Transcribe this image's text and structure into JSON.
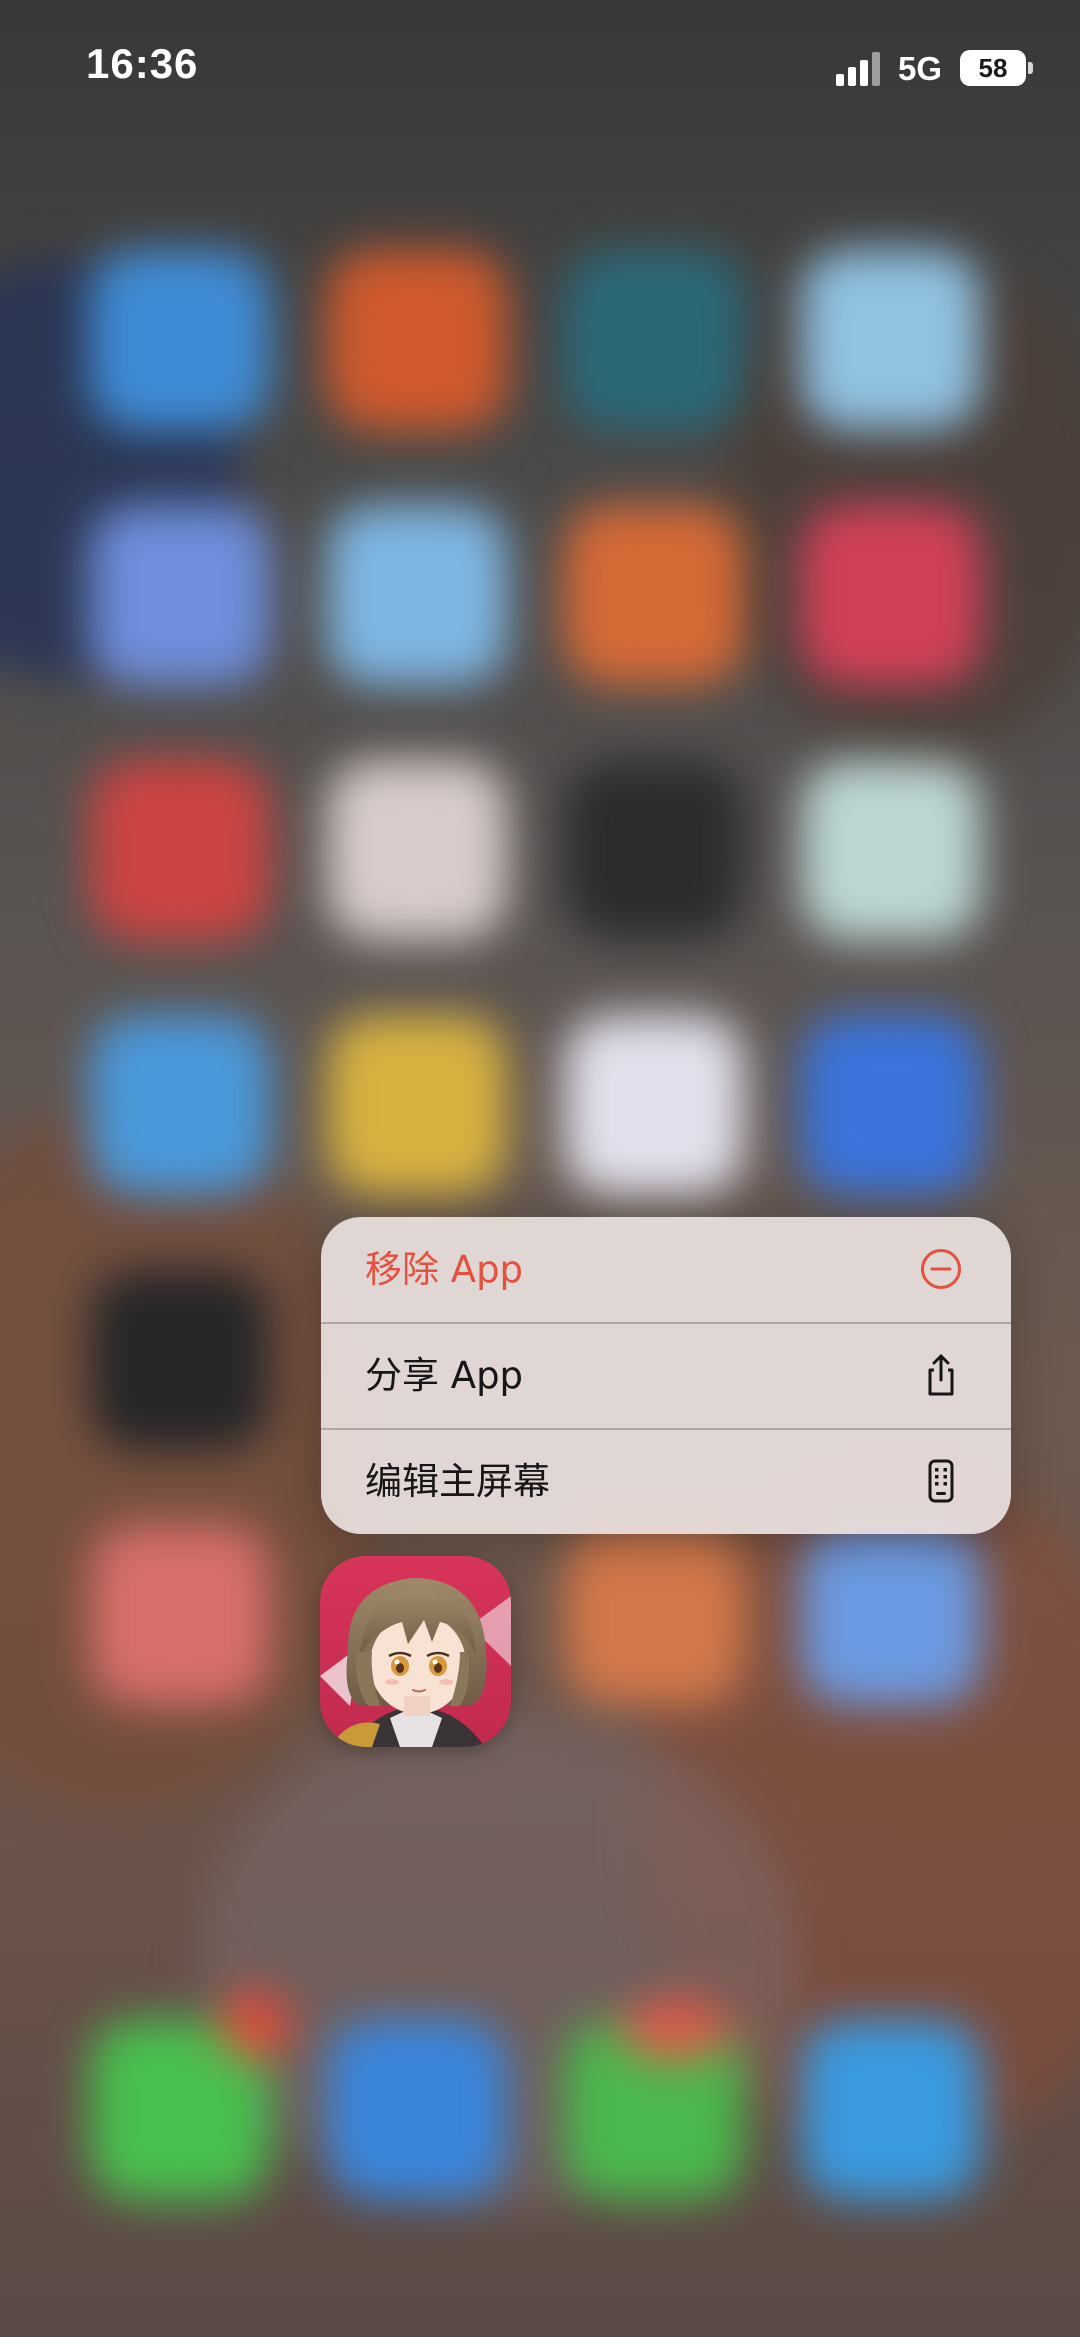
{
  "status_bar": {
    "time": "16:36",
    "network": "5G",
    "battery": "58"
  },
  "context_menu": {
    "items": [
      {
        "label": "移除 App",
        "icon": "minus-circle-icon",
        "style": "destructive",
        "color": "#e5513f"
      },
      {
        "label": "分享 App",
        "icon": "share-icon",
        "style": "default",
        "color": "#161616"
      },
      {
        "label": "编辑主屏幕",
        "icon": "phone-grid-icon",
        "style": "default",
        "color": "#161616"
      }
    ]
  },
  "app_icon": {
    "icon": "anime-girl-app-icon",
    "background": "#d43a5c"
  }
}
